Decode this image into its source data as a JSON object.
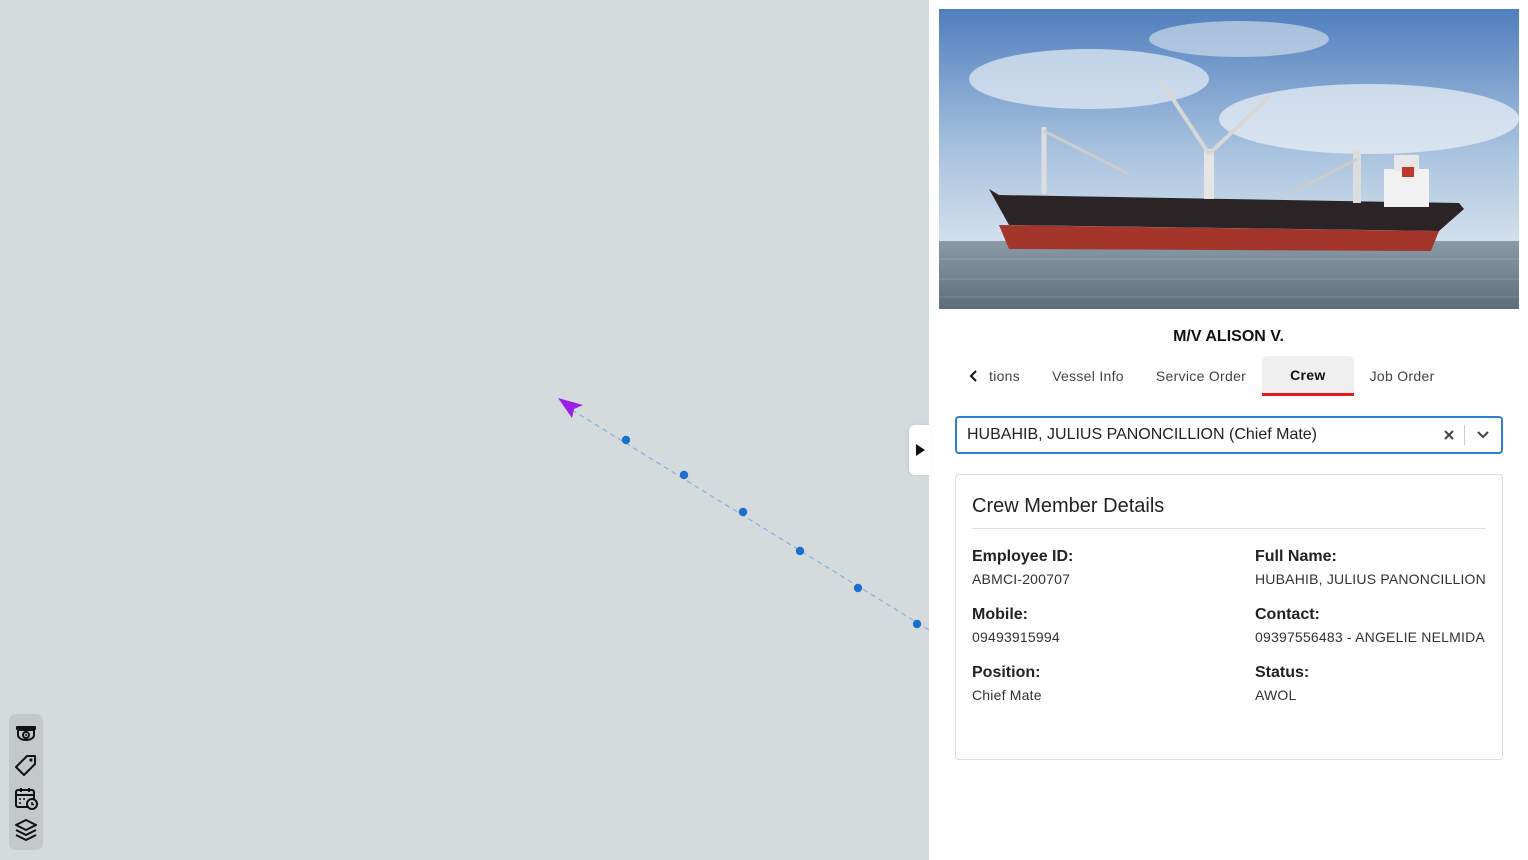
{
  "vessel": {
    "name": "M/V ALISON V."
  },
  "tabs": {
    "items": [
      {
        "label": "tions"
      },
      {
        "label": "Vessel Info"
      },
      {
        "label": "Service Order"
      },
      {
        "label": "Crew"
      },
      {
        "label": "Job Order"
      }
    ],
    "active": "Crew"
  },
  "crew_select": {
    "value": "HUBAHIB, JULIUS PANONCILLION (Chief Mate)"
  },
  "card": {
    "title": "Crew Member Details",
    "employee_id": {
      "label": "Employee ID:",
      "value": "ABMCI-200707"
    },
    "full_name": {
      "label": "Full Name:",
      "value": "HUBAHIB, JULIUS PANONCILLION"
    },
    "mobile": {
      "label": "Mobile:",
      "value": "09493915994"
    },
    "contact": {
      "label": "Contact:",
      "value": "09397556483 - ANGELIE NELMIDA"
    },
    "position": {
      "label": "Position:",
      "value": "Chief Mate"
    },
    "status": {
      "label": "Status:",
      "value": "AWOL"
    }
  },
  "map_tools": [
    "cctv-icon",
    "tag-icon",
    "calendar-clock-icon",
    "layers-icon"
  ],
  "colors": {
    "map_bg": "#d5dadd",
    "vessel_marker": "#9b1de8",
    "track_point": "#1c6fcf",
    "active_tab_underline": "#e51b1b",
    "select_border": "#2d7ed6"
  }
}
